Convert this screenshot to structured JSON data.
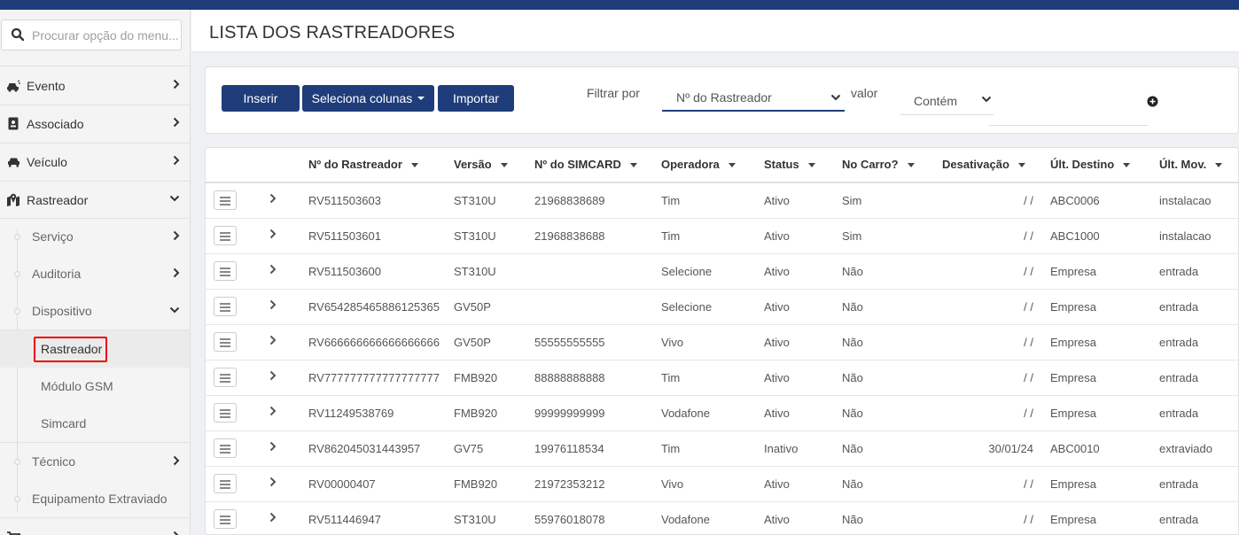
{
  "search": {
    "placeholder": "Procurar opção do menu..."
  },
  "sidebar": {
    "menu": [
      {
        "label": "Evento",
        "icon": "car-crash-icon"
      },
      {
        "label": "Associado",
        "icon": "id-card-icon"
      },
      {
        "label": "Veículo",
        "icon": "car-icon"
      },
      {
        "label": "Rastreador",
        "icon": "map-marker-icon"
      }
    ],
    "sub": [
      {
        "label": "Serviço"
      },
      {
        "label": "Auditoria"
      },
      {
        "label": "Dispositivo"
      },
      {
        "label": "Técnico"
      },
      {
        "label": "Equipamento Extraviado"
      }
    ],
    "sub2": [
      {
        "label": "Rastreador"
      },
      {
        "label": "Módulo GSM"
      },
      {
        "label": "Simcard"
      }
    ]
  },
  "page": {
    "title": "LISTA DOS RASTREADORES"
  },
  "toolbar": {
    "insert": "Inserir",
    "columns": "Seleciona colunas",
    "import": "Importar",
    "filter_label": "Filtrar por",
    "filter_value": "Nº do Rastreador",
    "valor_label": "valor",
    "condition_value": "Contém"
  },
  "table": {
    "headers": [
      "Nº do Rastreador",
      "Versão",
      "Nº do SIMCARD",
      "Operadora",
      "Status",
      "No Carro?",
      "Desativação",
      "Últ. Destino",
      "Últ. Mov."
    ],
    "rows": [
      [
        "RV511503603",
        "ST310U",
        "21968838689",
        "Tim",
        "Ativo",
        "Sim",
        "/ /",
        "ABC0006",
        "instalacao"
      ],
      [
        "RV511503601",
        "ST310U",
        "21968838688",
        "Tim",
        "Ativo",
        "Sim",
        "/ /",
        "ABC1000",
        "instalacao"
      ],
      [
        "RV511503600",
        "ST310U",
        "",
        "Selecione",
        "Ativo",
        "Não",
        "/ /",
        "Empresa",
        "entrada"
      ],
      [
        "RV654285465886125365",
        "GV50P",
        "",
        "Selecione",
        "Ativo",
        "Não",
        "/ /",
        "Empresa",
        "entrada"
      ],
      [
        "RV666666666666666666",
        "GV50P",
        "55555555555",
        "Vivo",
        "Ativo",
        "Não",
        "/ /",
        "Empresa",
        "entrada"
      ],
      [
        "RV777777777777777777",
        "FMB920",
        "88888888888",
        "Tim",
        "Ativo",
        "Não",
        "/ /",
        "Empresa",
        "entrada"
      ],
      [
        "RV11249538769",
        "FMB920",
        "99999999999",
        "Vodafone",
        "Ativo",
        "Não",
        "/ /",
        "Empresa",
        "entrada"
      ],
      [
        "RV862045031443957",
        "GV75",
        "19976118534",
        "Tim",
        "Inativo",
        "Não",
        "30/01/24",
        "ABC0010",
        "extraviado"
      ],
      [
        "RV00000407",
        "FMB920",
        "21972353212",
        "Vivo",
        "Ativo",
        "Não",
        "/ /",
        "Empresa",
        "entrada"
      ],
      [
        "RV511446947",
        "ST310U",
        "55976018078",
        "Vodafone",
        "Ativo",
        "Não",
        "/ /",
        "Empresa",
        "entrada"
      ]
    ]
  },
  "colors": {
    "primary": "#1f3d7a",
    "highlight": "#e00000"
  }
}
